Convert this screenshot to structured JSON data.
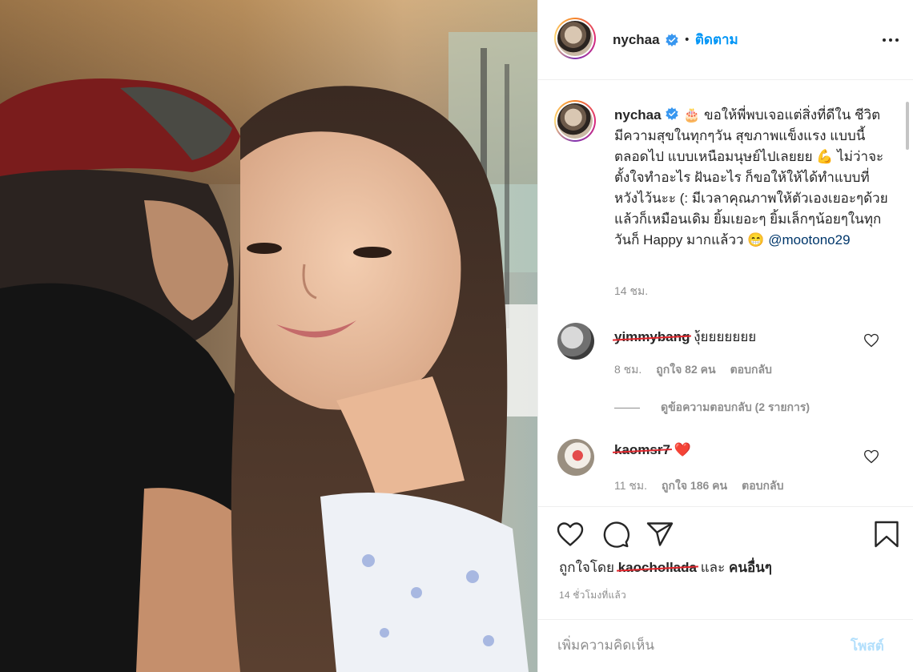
{
  "post": {
    "author": "nychaa",
    "follow_label": "ติดตาม",
    "separator": "•",
    "caption": {
      "username": "nychaa",
      "emoji_cake": "🎂",
      "text": "ขอให้พี่พบเจอแต่สิ่งที่ดีใน ชีวิต มีความสุขในทุกๆวัน สุขภาพแข็งแรง แบบนี้ตลอดไป แบบเหนือมนุษย์ไปเลยยย",
      "emoji_muscle": "💪",
      "text2": "ไม่ว่าจะตั้งใจทำอะไร ฝันอะไร ก็ขอให้ให้ได้ทำแบบที่หวังไว้นะะ (: มีเวลาคุณภาพให้ตัวเองเยอะๆด้วย แล้วก็เหมือนเดิม ยิ้มเยอะๆ ยิ้มเล็กๆน้อยๆในทุกวันก็ Happy มากแล้วว",
      "emoji_grin": "😁",
      "mention": "@mootono29",
      "time": "14 ชม."
    },
    "comments": [
      {
        "username": "yimmybang",
        "text": "งุ้ยยยยยยย",
        "time": "8 ชม.",
        "likes": "ถูกใจ 82 คน",
        "reply_label": "ตอบกลับ",
        "view_replies": "ดูข้อความตอบกลับ (2 รายการ)"
      },
      {
        "username": "kaomsr7",
        "text": "❤️",
        "time": "11 ชม.",
        "likes": "ถูกใจ 186 คน",
        "reply_label": "ตอบกลับ"
      }
    ],
    "liked_by_prefix": "ถูกใจโดย",
    "liked_by_user": "kaochollada",
    "liked_by_and": "และ",
    "liked_by_others": "คนอื่นๆ",
    "time_ago": "14 ชั่วโมงที่แล้ว",
    "comment_placeholder": "เพิ่มความคิดเห็น",
    "post_label": "โพสต์"
  },
  "icons": {
    "more": "more-options-icon",
    "verified": "verified-badge-icon",
    "like": "heart-icon",
    "comment": "comment-icon",
    "share": "share-icon",
    "save": "bookmark-icon"
  },
  "colors": {
    "link_blue": "#0095f6",
    "post_disabled": "#b2dffc",
    "mention": "#00376b",
    "redaction": "#e3262d",
    "heart_red": "#ed4956"
  }
}
